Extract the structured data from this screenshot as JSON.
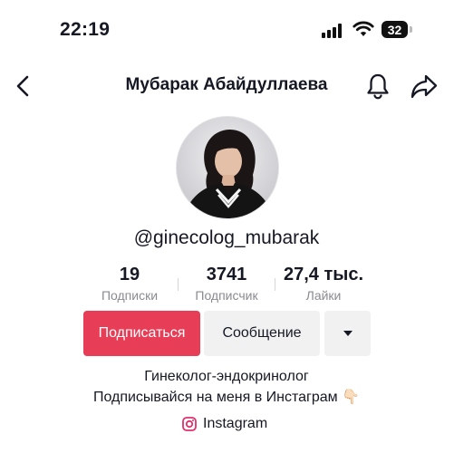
{
  "status": {
    "time": "22:19",
    "battery": "32"
  },
  "header": {
    "title": "Мубарак Абайдуллаева"
  },
  "profile": {
    "handle": "@ginecolog_mubarak"
  },
  "stats": [
    {
      "value": "19",
      "label": "Подписки"
    },
    {
      "value": "3741",
      "label": "Подписчик"
    },
    {
      "value": "27,4 тыс.",
      "label": "Лайки"
    }
  ],
  "actions": {
    "follow": "Подписаться",
    "message": "Сообщение"
  },
  "bio": {
    "line1": "Гинеколог-эндокринолог",
    "line2": "Подписывайся на меня в Инстаграм 👇🏻"
  },
  "link": {
    "label": "Instagram"
  },
  "colors": {
    "accent": "#e83d56",
    "secondary_bg": "#f1f1f2",
    "muted_text": "#8a8b91"
  },
  "icons": [
    "back-arrow-icon",
    "bell-icon",
    "share-icon",
    "dropdown-arrow-icon",
    "instagram-icon"
  ]
}
